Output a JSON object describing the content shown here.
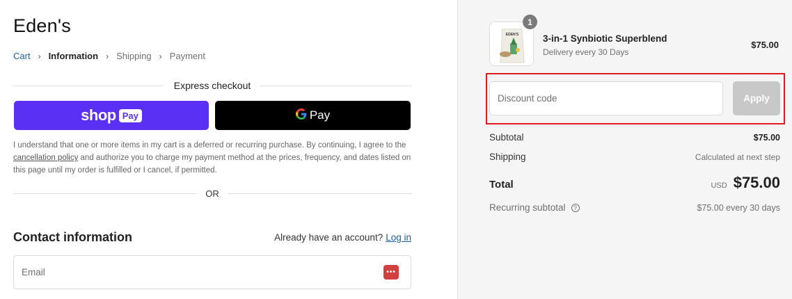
{
  "brand": "Eden's",
  "breadcrumb": {
    "cart": "Cart",
    "information": "Information",
    "shipping": "Shipping",
    "payment": "Payment"
  },
  "express": {
    "title": "Express checkout",
    "shop_word": "shop",
    "shop_pill": "Pay",
    "gpay_label": "Pay"
  },
  "notice": {
    "part1": "I understand that one or more items in my cart is a deferred or recurring purchase. By continuing, I agree to the ",
    "link": "cancellation policy",
    "part2": " and authorize you to charge my payment method at the prices, frequency, and dates listed on this page until my order is fulfilled or I cancel, if permitted."
  },
  "or_label": "OR",
  "contact": {
    "heading": "Contact information",
    "account_prompt": "Already have an account?",
    "login_label": "Log in",
    "email_placeholder": "Email"
  },
  "cart": {
    "quantity": "1",
    "product_name": "3-in-1 Synbiotic Superblend",
    "product_sub": "Delivery every 30 Days",
    "product_price": "$75.00",
    "image_brand": "EDEN'S"
  },
  "discount": {
    "placeholder": "Discount code",
    "apply_label": "Apply"
  },
  "summary": {
    "subtotal_label": "Subtotal",
    "subtotal_value": "$75.00",
    "shipping_label": "Shipping",
    "shipping_value": "Calculated at next step",
    "total_label": "Total",
    "currency": "USD",
    "total_value": "$75.00",
    "recurring_label": "Recurring subtotal",
    "recurring_value": "$75.00 every 30 days"
  },
  "colors": {
    "shop_pay": "#5a31f4",
    "link": "#1b5ea6",
    "highlight": "#e01b1b",
    "apply_disabled": "#c8c8c8"
  }
}
